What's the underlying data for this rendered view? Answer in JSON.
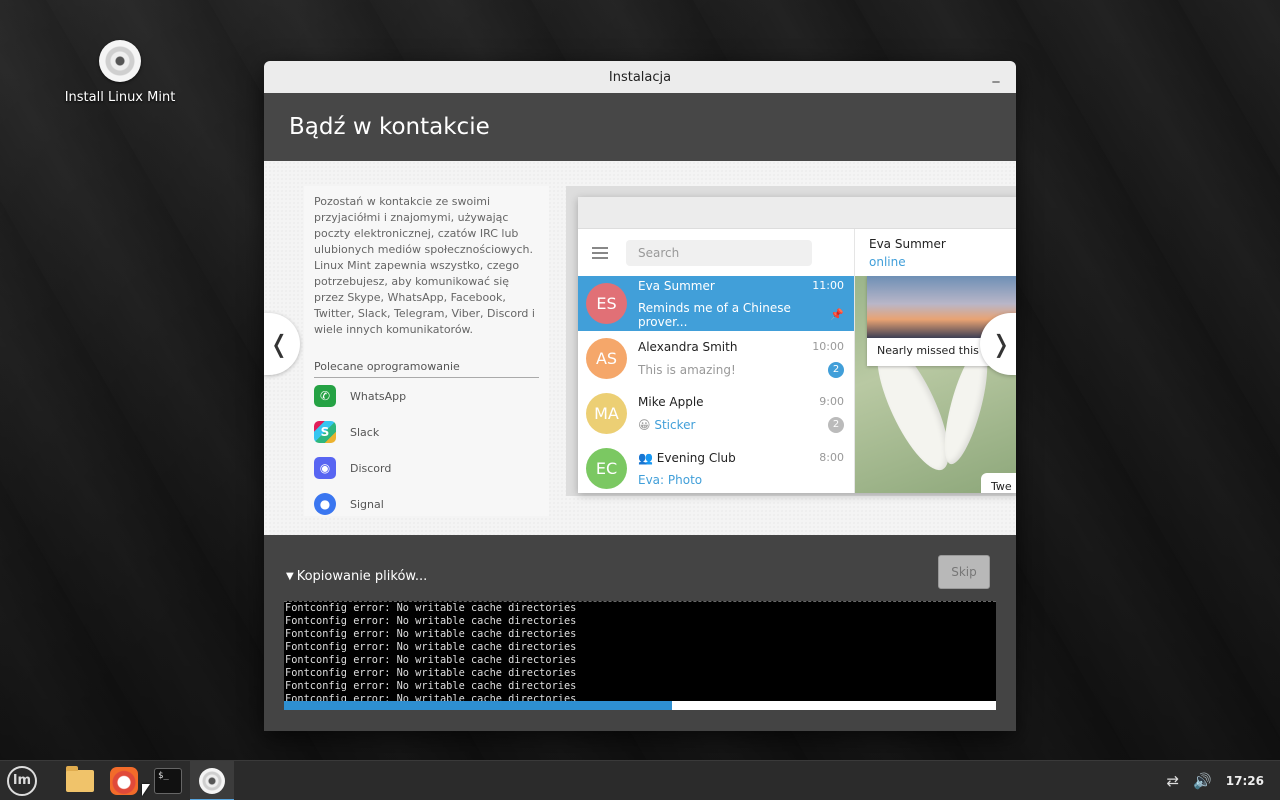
{
  "desktop": {
    "icon_label": "Install Linux Mint"
  },
  "window": {
    "title": "Instalacja",
    "minimize_glyph": "_"
  },
  "slide": {
    "heading": "Bądź w kontakcie",
    "description": "Pozostań w kontakcie ze swoimi przyjaciółmi i znajomymi, używając poczty elektronicznej, czatów IRC lub ulubionych mediów społecznościowych. Linux Mint zapewnia wszystko, czego potrzebujesz, aby komunikować się przez Skype, WhatsApp, Facebook, Twitter, Slack, Telegram, Viber, Discord i wiele innych komunikatorów.",
    "recommended_title": "Polecane oprogramowanie",
    "apps": [
      "WhatsApp",
      "Slack",
      "Discord",
      "Signal"
    ],
    "prev_glyph": "❬",
    "next_glyph": "❭"
  },
  "telegram": {
    "search_placeholder": "Search",
    "chats": [
      {
        "initials": "ES",
        "name": "Eva Summer",
        "time": "11:00",
        "preview": "Reminds me of a Chinese prover...",
        "color": "#e17076",
        "active": true
      },
      {
        "initials": "AS",
        "name": "Alexandra Smith",
        "time": "10:00",
        "preview": "This is amazing!",
        "badge": "2",
        "color": "#f5a76a"
      },
      {
        "initials": "MA",
        "name": "Mike Apple",
        "time": "9:00",
        "preview": "Sticker",
        "emoji": "😀",
        "badge": "2",
        "color": "#eccf74"
      },
      {
        "initials": "EC",
        "name": "Evening Club",
        "time": "8:00",
        "preview": "Eva: Photo",
        "color": "#7bc862"
      }
    ],
    "header_name": "Eva Summer",
    "header_status": "online",
    "photo_caption": "Nearly missed this s",
    "bubble_text": "Twe"
  },
  "progress": {
    "status_text": "Kopiowanie plików...",
    "skip_label": "Skip",
    "percent": 54.5,
    "log_lines": [
      "Fontconfig error: No writable cache directories",
      "Fontconfig error: No writable cache directories",
      "Fontconfig error: No writable cache directories",
      "Fontconfig error: No writable cache directories",
      "Fontconfig error: No writable cache directories",
      "Fontconfig error: No writable cache directories",
      "Fontconfig error: No writable cache directories",
      "Fontconfig error: No writable cache directories"
    ]
  },
  "taskbar": {
    "terminal_glyph": "$_",
    "clock": "17:26",
    "icons": [
      "mint-menu-icon",
      "files-icon",
      "firefox-icon",
      "terminal-icon",
      "installer-icon",
      "network-icon",
      "volume-icon"
    ]
  },
  "colors": {
    "accent": "#419fd9",
    "progress": "#2e8fd1"
  }
}
